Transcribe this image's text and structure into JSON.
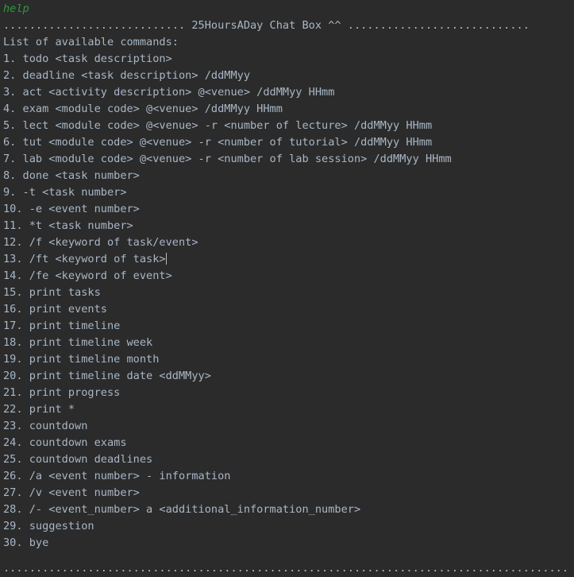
{
  "console": {
    "title_banner": "............................ 25HoursADay Chat Box ^^ ............................",
    "separator_top": ".......................................................................................",
    "separator_bottom": ".......................................................................................",
    "user_input_echo": "help",
    "list_heading": "List of available commands:",
    "commands": [
      "1. todo <task description>",
      "2. deadline <task description> /ddMMyy",
      "3. act <activity description> @<venue> /ddMMyy HHmm",
      "4. exam <module code> @<venue> /ddMMyy HHmm",
      "5. lect <module code> @<venue> -r <number of lecture> /ddMMyy HHmm",
      "6. tut <module code> @<venue> -r <number of tutorial> /ddMMyy HHmm",
      "7. lab <module code> @<venue> -r <number of lab session> /ddMMyy HHmm",
      "8. done <task number>",
      "9. -t <task number>",
      "10. -e <event number>",
      "11. *t <task number>",
      "12. /f <keyword of task/event>",
      "13. /ft <keyword of task>",
      "14. /fe <keyword of event>",
      "15. print tasks",
      "16. print events",
      "17. print timeline",
      "18. print timeline week",
      "19. print timeline month",
      "20. print timeline date <ddMMyy>",
      "21. print progress",
      "22. print *",
      "23. countdown",
      "24. countdown exams",
      "25. countdown deadlines",
      "26. /a <event number> - information",
      "27. /v <event number>",
      "28. /- <event_number> a <additional_information_number>",
      "29. suggestion",
      "30. bye"
    ],
    "caret_after_command_index": 12,
    "colors": {
      "background": "#2b2b2b",
      "foreground": "#a9b7c6",
      "echo_green": "#2d9a3b",
      "caret": "#bbbbbb"
    }
  }
}
